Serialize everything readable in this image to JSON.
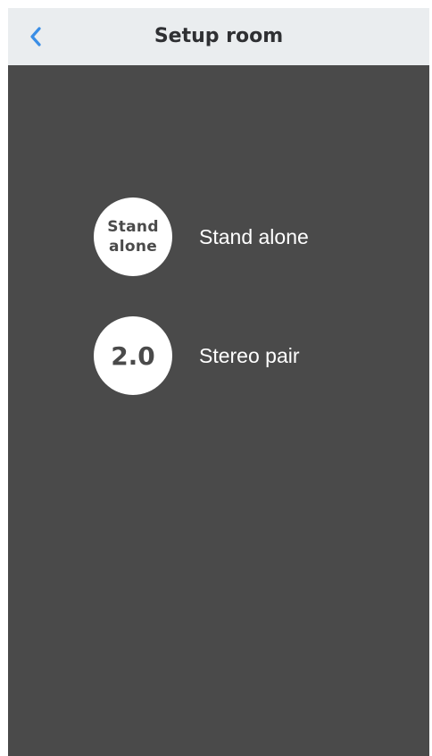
{
  "header": {
    "title": "Setup room",
    "back_icon": "chevron-left-icon",
    "back_color": "#3a8ee6",
    "background": "#eaedef"
  },
  "content": {
    "background": "#4a4a4a"
  },
  "options": [
    {
      "badge": "Stand\nalone",
      "label": "Stand alone"
    },
    {
      "badge": "2.0",
      "label": "Stereo pair"
    }
  ]
}
